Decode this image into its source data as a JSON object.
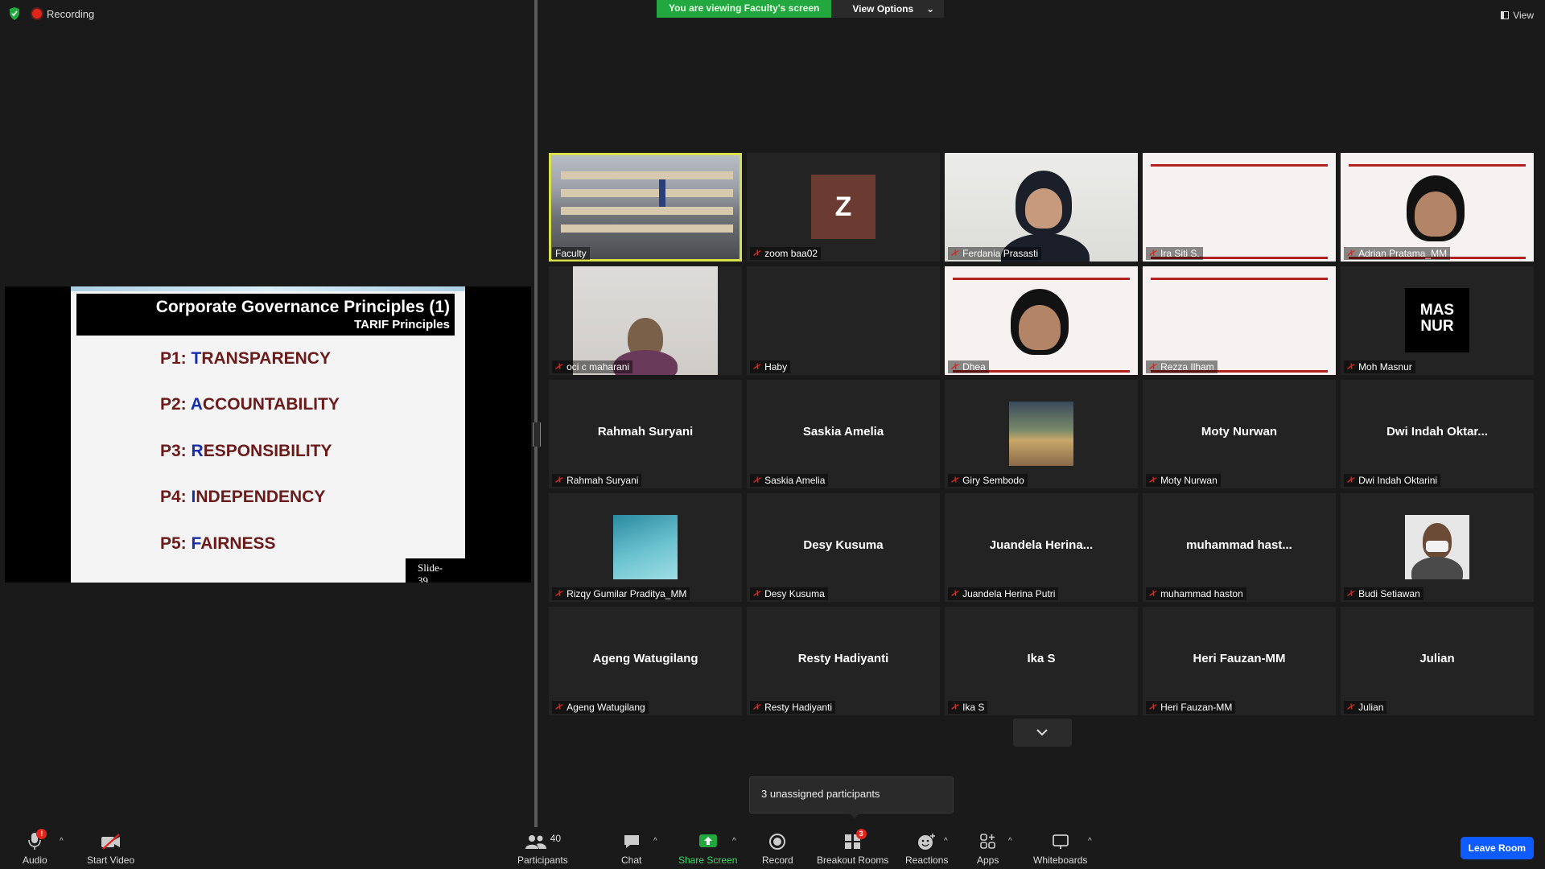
{
  "top": {
    "recording_label": "Recording",
    "banner_text": "You are viewing Faculty's screen",
    "view_options_label": "View Options",
    "view_label": "View"
  },
  "slide": {
    "title": "Corporate Governance Principles (1)",
    "subtitle": "TARIF Principles",
    "items": [
      {
        "prefix": "P1: ",
        "letter": "T",
        "rest": "RANSPARENCY"
      },
      {
        "prefix": "P2: ",
        "letter": "A",
        "rest": "CCOUNTABILITY"
      },
      {
        "prefix": "P3: ",
        "letter": "R",
        "rest": "ESPONSIBILITY"
      },
      {
        "prefix": "P4: ",
        "letter": "I",
        "rest": "NDEPENDENCY"
      },
      {
        "prefix": "P5: ",
        "letter": "F",
        "rest": "AIRNESS"
      }
    ],
    "slide_number": "Slide-39",
    "slide_text_color": "#6b1a1a",
    "highlight_color": "#1a2da8"
  },
  "participants": [
    {
      "label": "Faculty",
      "muted": false,
      "kind": "classroom",
      "active": true
    },
    {
      "label": "zoom baa02",
      "muted": true,
      "kind": "avatar",
      "avatar_letter": "Z"
    },
    {
      "label": "Ferdania Prasasti",
      "muted": true,
      "kind": "webcam-headphones"
    },
    {
      "label": "Ira Siti S.",
      "muted": true,
      "kind": "slide-bg"
    },
    {
      "label": "Adrian Pratama_MM",
      "muted": true,
      "kind": "slide-bg-person"
    },
    {
      "label": "oci c maharani",
      "muted": true,
      "kind": "webcam-hijab"
    },
    {
      "label": "Haby",
      "muted": true,
      "kind": "blank"
    },
    {
      "label": "Dhea",
      "muted": true,
      "kind": "slide-bg-person"
    },
    {
      "label": "Rezza Ilham",
      "muted": true,
      "kind": "slide-bg"
    },
    {
      "label": "Moh Masnur",
      "muted": true,
      "kind": "logo",
      "logo_text": [
        "MAS",
        "NUR"
      ]
    },
    {
      "label": "Rahmah Suryani",
      "muted": true,
      "kind": "name",
      "display": "Rahmah Suryani"
    },
    {
      "label": "Saskia Amelia",
      "muted": true,
      "kind": "name",
      "display": "Saskia Amelia"
    },
    {
      "label": "Giry Sembodo",
      "muted": true,
      "kind": "photo-room"
    },
    {
      "label": "Moty Nurwan",
      "muted": true,
      "kind": "name",
      "display": "Moty Nurwan"
    },
    {
      "label": "Dwi Indah Oktarini",
      "muted": true,
      "kind": "name",
      "display": "Dwi Indah Oktar..."
    },
    {
      "label": "Rizqy Gumilar Praditya_MM",
      "muted": true,
      "kind": "photo-sky"
    },
    {
      "label": "Desy Kusuma",
      "muted": true,
      "kind": "name",
      "display": "Desy Kusuma"
    },
    {
      "label": "Juandela Herina Putri",
      "muted": true,
      "kind": "name",
      "display": "Juandela  Herina..."
    },
    {
      "label": "muhammad haston",
      "muted": true,
      "kind": "name",
      "display": "muhammad  hast..."
    },
    {
      "label": "Budi Setiawan",
      "muted": true,
      "kind": "photo-mask"
    },
    {
      "label": "Ageng Watugilang",
      "muted": true,
      "kind": "name",
      "display": "Ageng Watugilang"
    },
    {
      "label": "Resty Hadiyanti",
      "muted": true,
      "kind": "name",
      "display": "Resty Hadiyanti"
    },
    {
      "label": "Ika S",
      "muted": true,
      "kind": "name",
      "display": "Ika S"
    },
    {
      "label": "Heri Fauzan-MM",
      "muted": true,
      "kind": "name",
      "display": "Heri Fauzan-MM"
    },
    {
      "label": "Julian",
      "muted": true,
      "kind": "name",
      "display": "Julian"
    }
  ],
  "tooltip": "3 unassigned participants",
  "toolbar": {
    "audio": "Audio",
    "audio_badge": "!",
    "start_video": "Start Video",
    "participants": "Participants",
    "participants_count": "40",
    "chat": "Chat",
    "share_screen": "Share Screen",
    "record": "Record",
    "breakout_rooms": "Breakout Rooms",
    "breakout_badge": "3",
    "reactions": "Reactions",
    "apps": "Apps",
    "whiteboards": "Whiteboards",
    "leave": "Leave Room"
  },
  "colors": {
    "banner_green": "#23a73f",
    "leave_blue": "#0e5cff",
    "active_outline": "#d9e14a",
    "mute_red": "#e0251b"
  }
}
